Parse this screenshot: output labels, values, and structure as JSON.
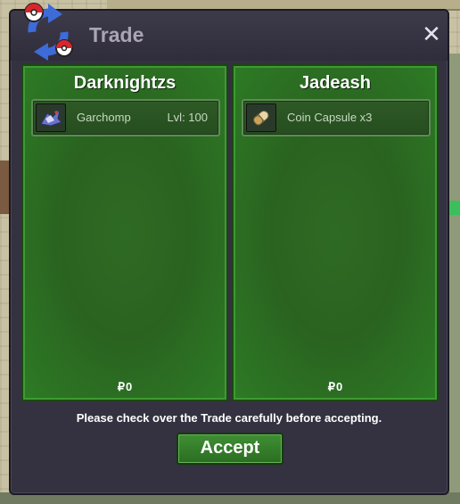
{
  "window": {
    "title": "Trade",
    "close_glyph": "✕"
  },
  "icons": {
    "logo": "trade-arrows-pokeball-logo",
    "close": "close-icon",
    "left_item": "garchomp-icon",
    "right_item": "coin-capsule-icon",
    "currency": "pokedollar-icon"
  },
  "colors": {
    "panel_green": "#2d7b25",
    "window_bg": "#343140",
    "title_text": "#a9a5b6",
    "accept_green": "#3f8f33"
  },
  "left_panel": {
    "player_name": "Darknightzs",
    "items": [
      {
        "name": "Garchomp",
        "level": "Lvl: 100"
      }
    ],
    "money_symbol": "₽",
    "money": "0"
  },
  "right_panel": {
    "player_name": "Jadeash",
    "items": [
      {
        "name": "Coin Capsule  x3"
      }
    ],
    "money_symbol": "₽",
    "money": "0"
  },
  "notice": "Please check over the Trade carefully before accepting.",
  "accept_label": "Accept"
}
